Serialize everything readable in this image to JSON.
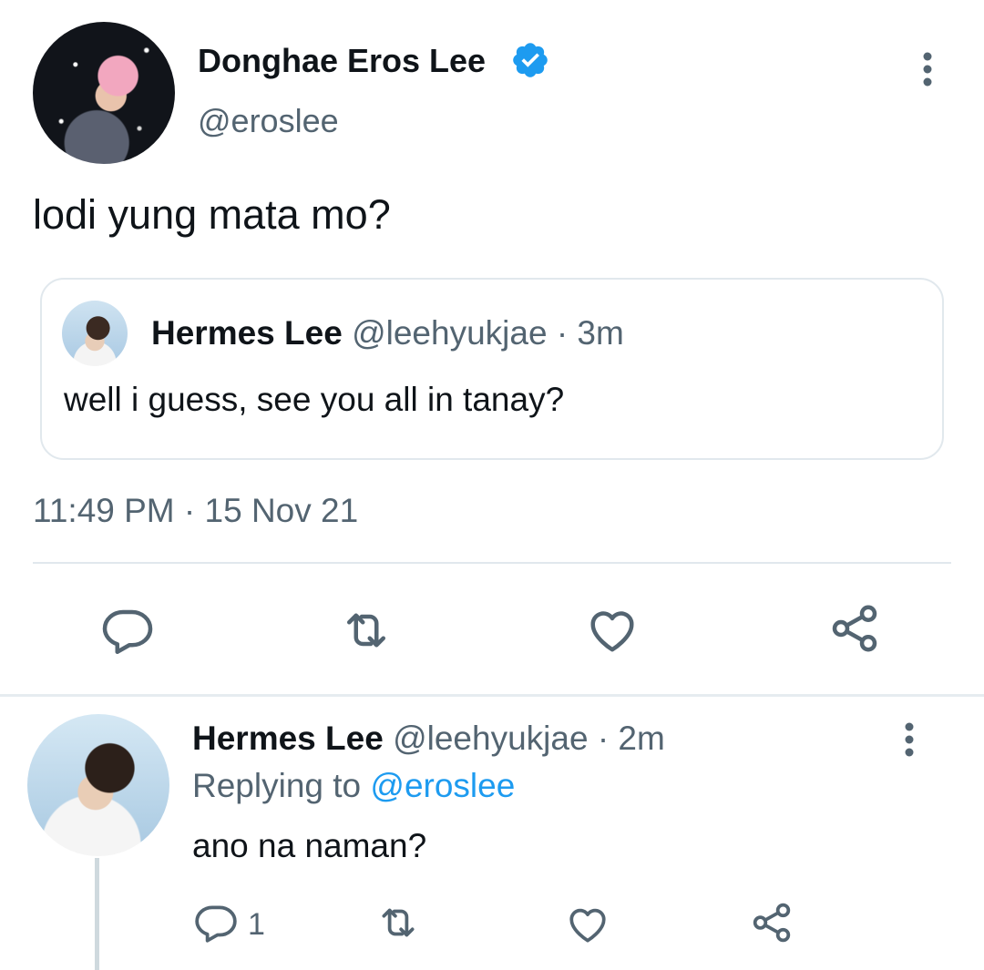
{
  "main_tweet": {
    "display_name": "Donghae Eros Lee",
    "handle": "@eroslee",
    "verified": true,
    "text": "lodi yung mata mo?",
    "timestamp": "11:49 PM · 15 Nov 21",
    "quoted_tweet": {
      "display_name": "Hermes Lee",
      "meta": " @leehyukjae · 3m",
      "text": "well i guess, see you all in tanay?"
    },
    "actions": [
      "reply-icon",
      "retweet-icon",
      "like-icon",
      "share-icon"
    ]
  },
  "reply_tweet": {
    "display_name": "Hermes Lee",
    "meta": " @leehyukjae · 2m",
    "replying_prefix": "Replying to ",
    "replying_handle": "@eroslee",
    "text": "ano na naman?",
    "reply_count": "1",
    "actions": [
      "reply-icon",
      "retweet-icon",
      "like-icon",
      "share-icon"
    ]
  },
  "colors": {
    "text_primary": "#0f1419",
    "text_secondary": "#536471",
    "accent": "#1d9bf0",
    "divider": "#e1e8ed"
  }
}
